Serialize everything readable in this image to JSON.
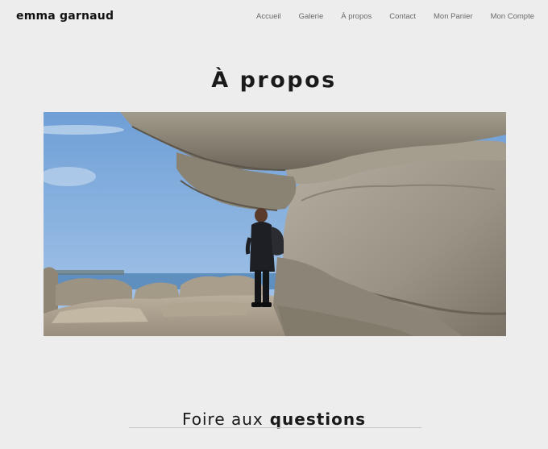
{
  "site": {
    "brand": "emma garnaud"
  },
  "nav": {
    "items": [
      "Accueil",
      "Galerie",
      "À propos",
      "Contact",
      "Mon Panier",
      "Mon Compte"
    ]
  },
  "page": {
    "title": "À propos"
  },
  "faq": {
    "title_light": "Foire aux",
    "title_bold": "questions"
  }
}
